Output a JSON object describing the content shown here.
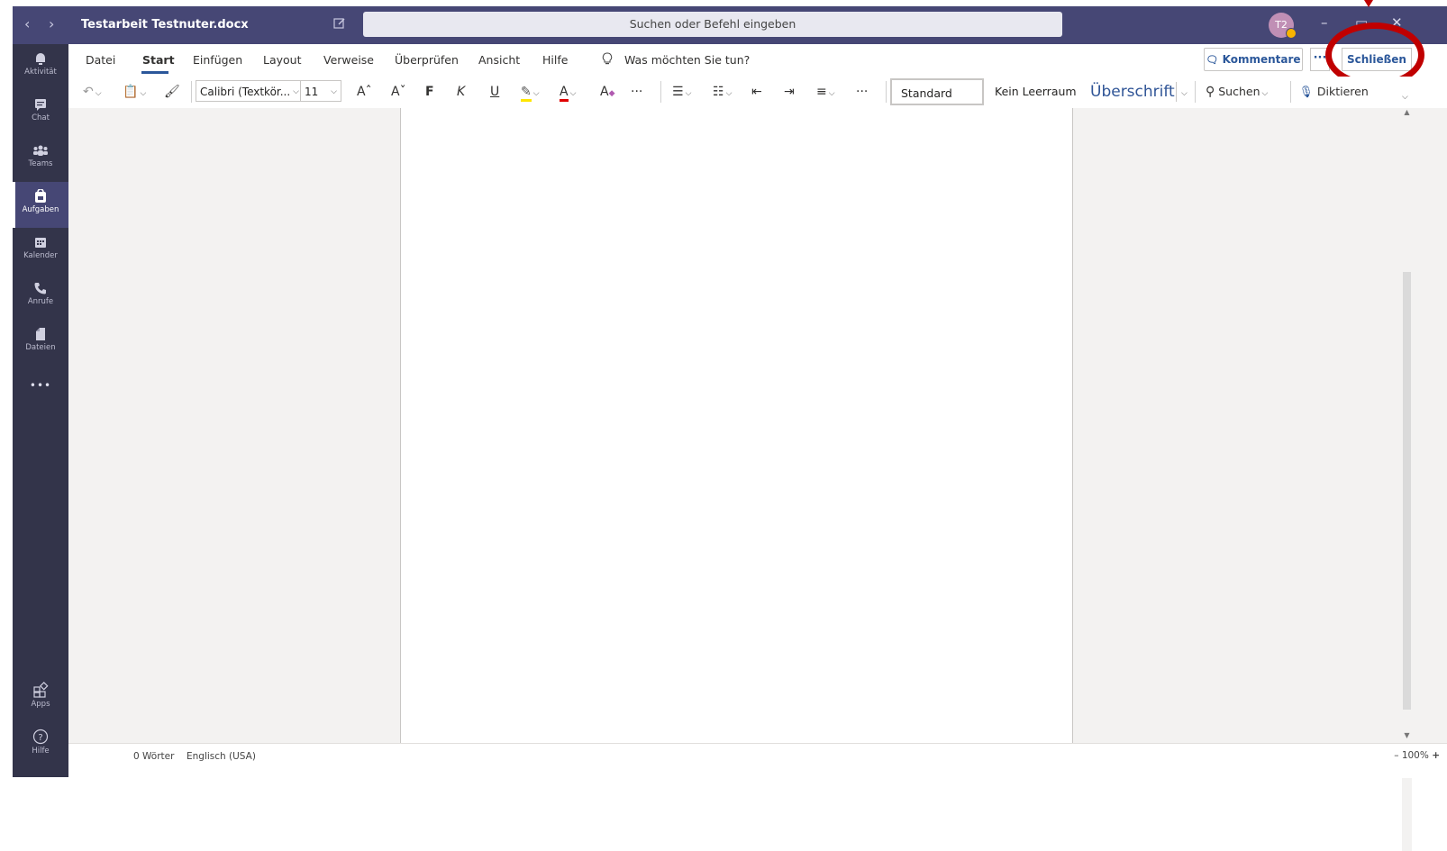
{
  "titlebar": {
    "nav_back": "‹",
    "nav_forward": "›",
    "doc_title": "Testarbeit Testnuter.docx",
    "search_placeholder": "Suchen oder Befehl eingeben",
    "avatar_initials": "T2",
    "minimize": "–",
    "maximize": "▭",
    "close": "✕"
  },
  "rail": {
    "items": [
      {
        "label": "Aktivität",
        "icon": "bell-icon"
      },
      {
        "label": "Chat",
        "icon": "chat-icon"
      },
      {
        "label": "Teams",
        "icon": "teams-icon"
      },
      {
        "label": "Aufgaben",
        "icon": "assignments-icon",
        "active": true
      },
      {
        "label": "Kalender",
        "icon": "calendar-icon"
      },
      {
        "label": "Anrufe",
        "icon": "phone-icon"
      },
      {
        "label": "Dateien",
        "icon": "files-icon"
      }
    ],
    "more": "•••",
    "apps_label": "Apps",
    "help_label": "Hilfe"
  },
  "ribbon": {
    "tabs": [
      "Datei",
      "Start",
      "Einfügen",
      "Layout",
      "Verweise",
      "Überprüfen",
      "Ansicht",
      "Hilfe"
    ],
    "active_tab": "Start",
    "tell_me": "Was möchten Sie tun?",
    "kommentare": "Kommentare",
    "more": "···",
    "schliessen": "Schließen",
    "font_name": "Calibri (Textkör...",
    "font_size": "11",
    "grow_font": "Aˆ",
    "shrink_font": "Aˇ",
    "bold": "F",
    "italic": "K",
    "underline": "U",
    "font_color": "A",
    "clear_format": "A",
    "ellipsis": "···",
    "styles": [
      "Standard",
      "Kein Leerraum",
      "Überschrift"
    ],
    "search_label": "Suchen",
    "dictate_label": "Diktieren"
  },
  "status": {
    "words": "0 Wörter",
    "language": "Englisch (USA)",
    "zoom_minus": "–",
    "zoom": "100%",
    "zoom_plus": "+"
  },
  "colors": {
    "titlebar": "#464775",
    "rail": "#33344a",
    "accent": "#2b579a",
    "callout": "#c00000"
  }
}
